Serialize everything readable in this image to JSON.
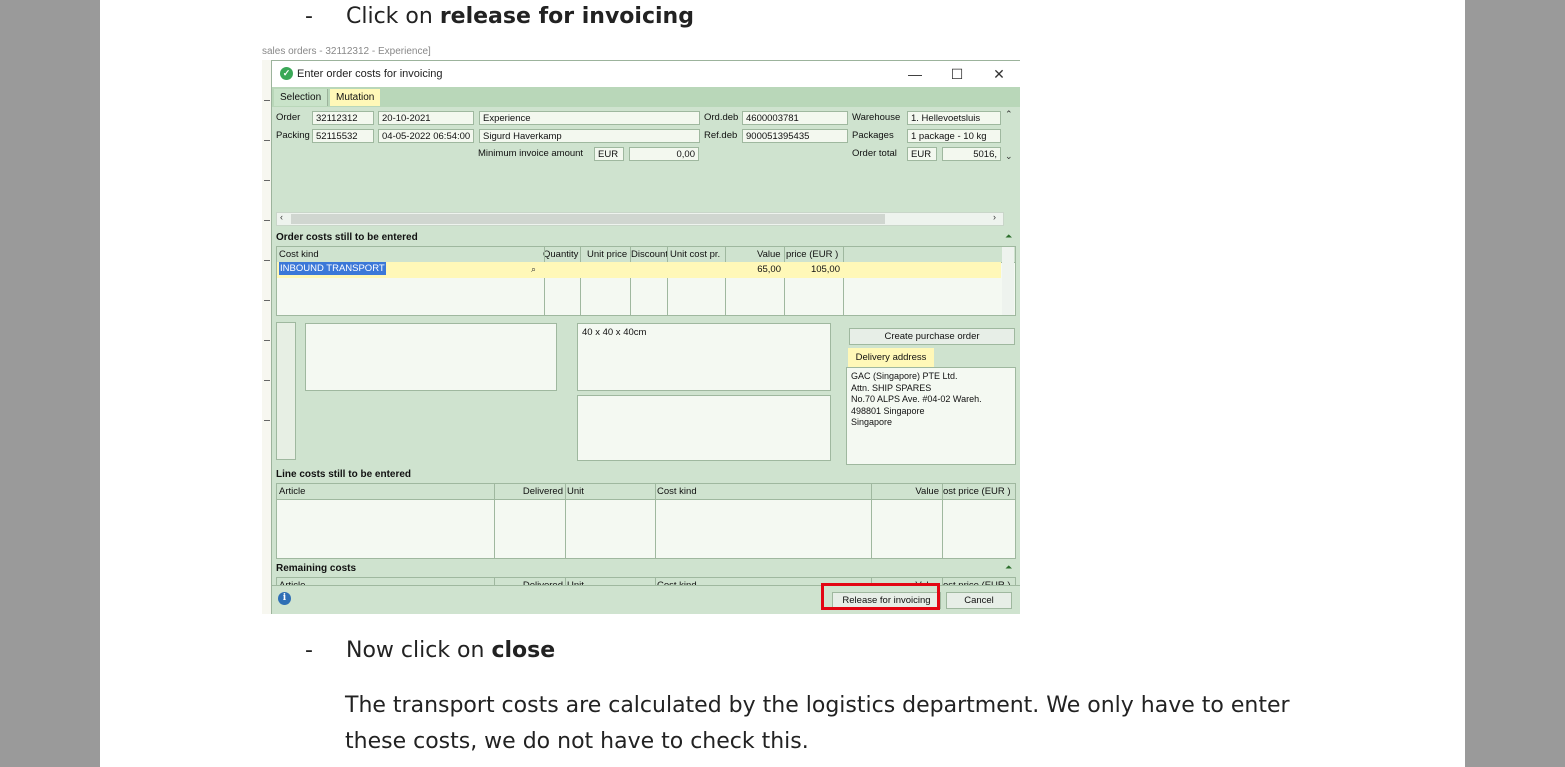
{
  "doc": {
    "bullet1_dash": "-",
    "bullet1_prefix": "Click on ",
    "bullet1_bold": "release for invoicing",
    "bullet2_dash": "-",
    "bullet2_prefix": "Now click on ",
    "bullet2_bold": "close",
    "paragraph": "The transport costs are calculated by the logistics department. We only have to enter these costs, we do not have to check this."
  },
  "background_window": {
    "title": "sales orders - 32112312 - Experience]"
  },
  "window": {
    "title": "Enter order costs for invoicing",
    "minimize": "—",
    "maximize": "☐",
    "close": "✕"
  },
  "tabs": [
    {
      "label": "Selection"
    },
    {
      "label": "Mutation"
    }
  ],
  "header": {
    "order_label": "Order",
    "order_no": "32112312",
    "order_date": "20-10-2021",
    "order_desc": "Experience",
    "packing_label": "Packing l",
    "packing_no": "52115532",
    "packing_datetime": "04-05-2022 06:54:00",
    "packing_person": "Sigurd Haverkamp",
    "min_invoice_label": "Minimum invoice amount",
    "min_invoice_currency": "EUR",
    "min_invoice_value": "0,00",
    "orddeb_label": "Ord.deb",
    "orddeb_value": "4600003781",
    "refdeb_label": "Ref.deb",
    "refdeb_value": "900051395435",
    "warehouse_label": "Warehouse",
    "warehouse_value": "1. Hellevoetsluis",
    "packages_label": "Packages",
    "packages_value": "1 package - 10 kg",
    "ordertotal_label": "Order total",
    "ordertotal_currency": "EUR",
    "ordertotal_value": "5016,"
  },
  "order_costs": {
    "title": "Order costs still to be entered",
    "columns": [
      "Cost kind",
      "Quantity",
      "Unit price",
      "Discount",
      "Unit cost pr.",
      "Value",
      "price (EUR )"
    ],
    "row": {
      "cost_kind": "INBOUND TRANSPORT",
      "value": "65,00",
      "price": "105,00"
    }
  },
  "memos": {
    "dimensions": "40 x 40 x 40cm"
  },
  "create_po_button": "Create purchase order",
  "delivery_address": {
    "tab": "Delivery address",
    "text": "GAC (Singapore) PTE Ltd.\nAttn. SHIP SPARES\nNo.70 ALPS Ave. #04-02 Wareh.\n498801  Singapore\nSingapore"
  },
  "line_costs": {
    "title": "Line costs still to be entered",
    "columns": [
      "Article",
      "Delivered",
      "Unit",
      "Cost kind",
      "Value",
      "ost price (EUR )"
    ]
  },
  "remaining_costs": {
    "title": "Remaining costs",
    "columns": [
      "Article",
      "Delivered",
      "Unit",
      "Cost kind",
      "Value",
      "ost price (EUR )"
    ]
  },
  "footer": {
    "info_icon": "i",
    "release_button": "Release for invoicing",
    "cancel_button": "Cancel"
  },
  "highlight_color": "#e30613"
}
